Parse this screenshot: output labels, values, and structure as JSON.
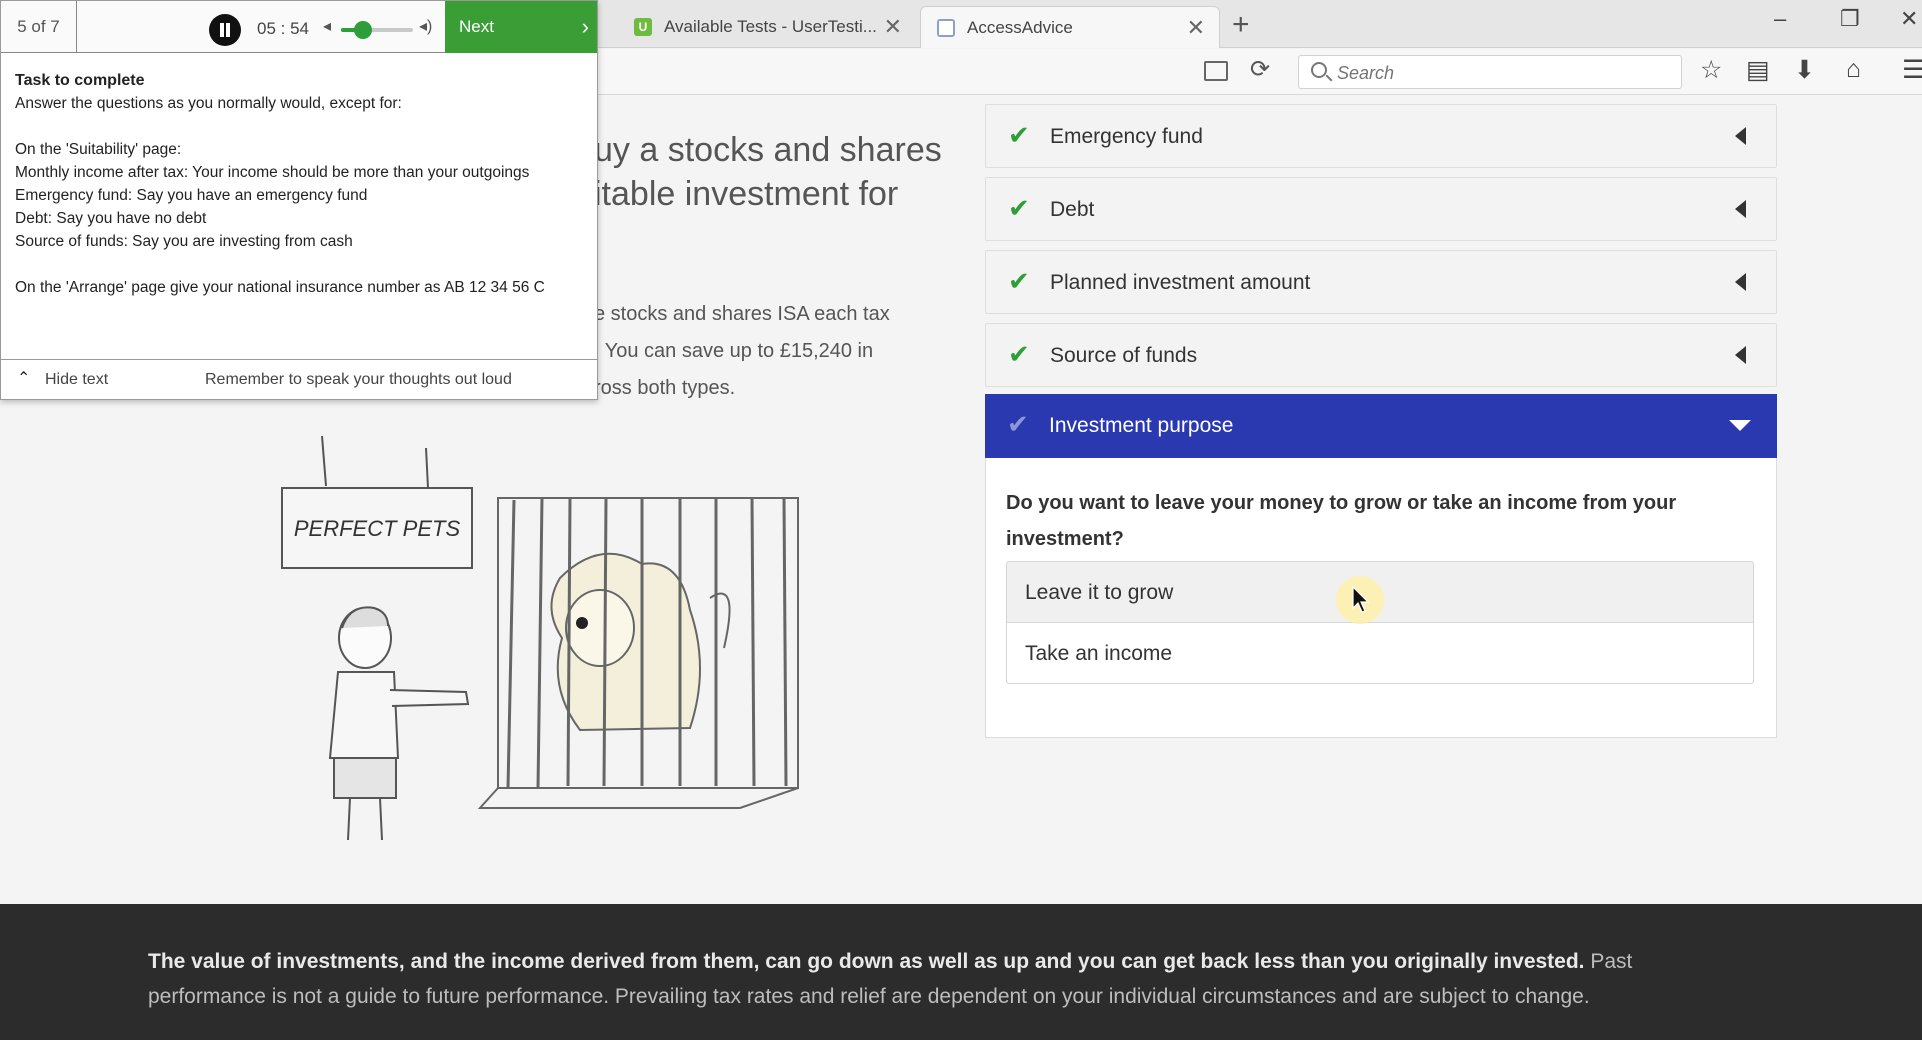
{
  "browser": {
    "tabs": [
      {
        "title": "Available Tests - UserTesti...",
        "favicon": "usertesting-icon"
      },
      {
        "title": "AccessAdvice",
        "favicon": "page-icon",
        "active": true
      }
    ],
    "close_glyph": "✕",
    "new_tab_glyph": "+",
    "search_placeholder": "Search",
    "window_controls": {
      "minimize": "–",
      "restore": "❐",
      "close": "✕"
    }
  },
  "usertesting": {
    "step": "5 of 7",
    "timer": "05 : 54",
    "volume_level": 0.3,
    "next_label": "Next",
    "task_title": "Task to complete",
    "task_lines": [
      "Answer the questions as you normally would, except for:",
      "",
      "On the 'Suitability' page:",
      "Monthly income after tax: Your income should be more than your outgoings",
      "Emergency fund: Say you have an emergency fund",
      "Debt: Say you have no debt",
      "Source of funds: Say you are investing from cash",
      "",
      "On the 'Arrange' page give your national insurance number as AB 12 34 56 C"
    ],
    "hide_text_label": "Hide text",
    "reminder": "Remember to speak your thoughts out loud"
  },
  "page": {
    "hero_heading": "uy a stocks and shares\nitable investment for",
    "hero_body": "e stocks and shares ISA each tax\n. You can save up to £15,240 in\nross both types.",
    "illustration_sign": "PERFECT PETS"
  },
  "accordion": {
    "completed_items": [
      {
        "label": "Emergency fund"
      },
      {
        "label": "Debt"
      },
      {
        "label": "Planned investment amount"
      },
      {
        "label": "Source of funds"
      }
    ],
    "open_item": {
      "label": "Investment purpose",
      "question": "Do you want to leave your money to grow or take an income from your investment?",
      "options": [
        "Leave it to grow",
        "Take an income"
      ]
    }
  },
  "footer": {
    "bold_text": "The value of investments, and the income derived from them, can go down as well as up and you can get back less than you originally invested.",
    "normal_text": " Past performance is not a guide to future performance. Prevailing tax rates and relief are dependent on your individual circumstances and are subject to change."
  },
  "colors": {
    "accent_blue": "#2a39b0",
    "check_green": "#2e9e3a",
    "next_green": "#3a9d35",
    "footer_bg": "#2c2c2c"
  }
}
